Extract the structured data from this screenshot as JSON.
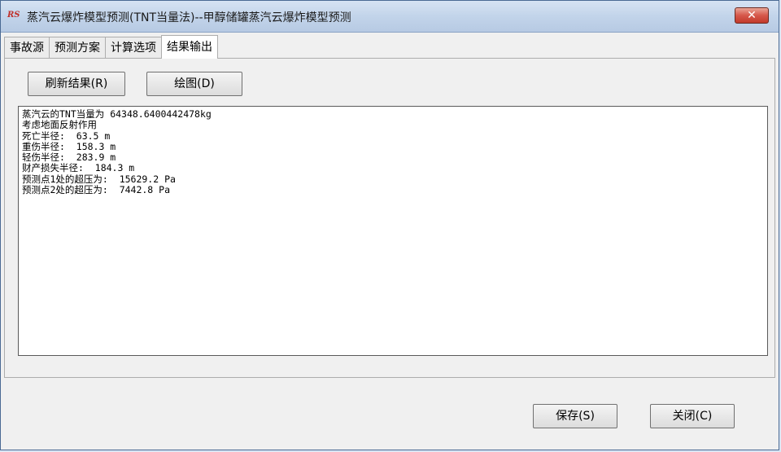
{
  "window": {
    "title": "蒸汽云爆炸模型预测(TNT当量法)--甲醇储罐蒸汽云爆炸模型预测",
    "app_icon_text": "RS",
    "close_symbol": "✕"
  },
  "tabs": [
    {
      "label": "事故源",
      "active": false
    },
    {
      "label": "预测方案",
      "active": false
    },
    {
      "label": "计算选项",
      "active": false
    },
    {
      "label": "结果输出",
      "active": true
    }
  ],
  "toolbar": {
    "refresh_label": "刷新结果(R)",
    "plot_label": "绘图(D)"
  },
  "results": [
    "蒸汽云的TNT当量为 64348.6400442478kg",
    "考虑地面反射作用",
    "死亡半径:  63.5 m",
    "重伤半径:  158.3 m",
    "轻伤半径:  283.9 m",
    "财产损失半径:  184.3 m",
    "预测点1处的超压为:  15629.2 Pa",
    "预测点2处的超压为:  7442.8 Pa"
  ],
  "footer": {
    "save_label": "保存(S)",
    "close_label": "关闭(C)"
  }
}
